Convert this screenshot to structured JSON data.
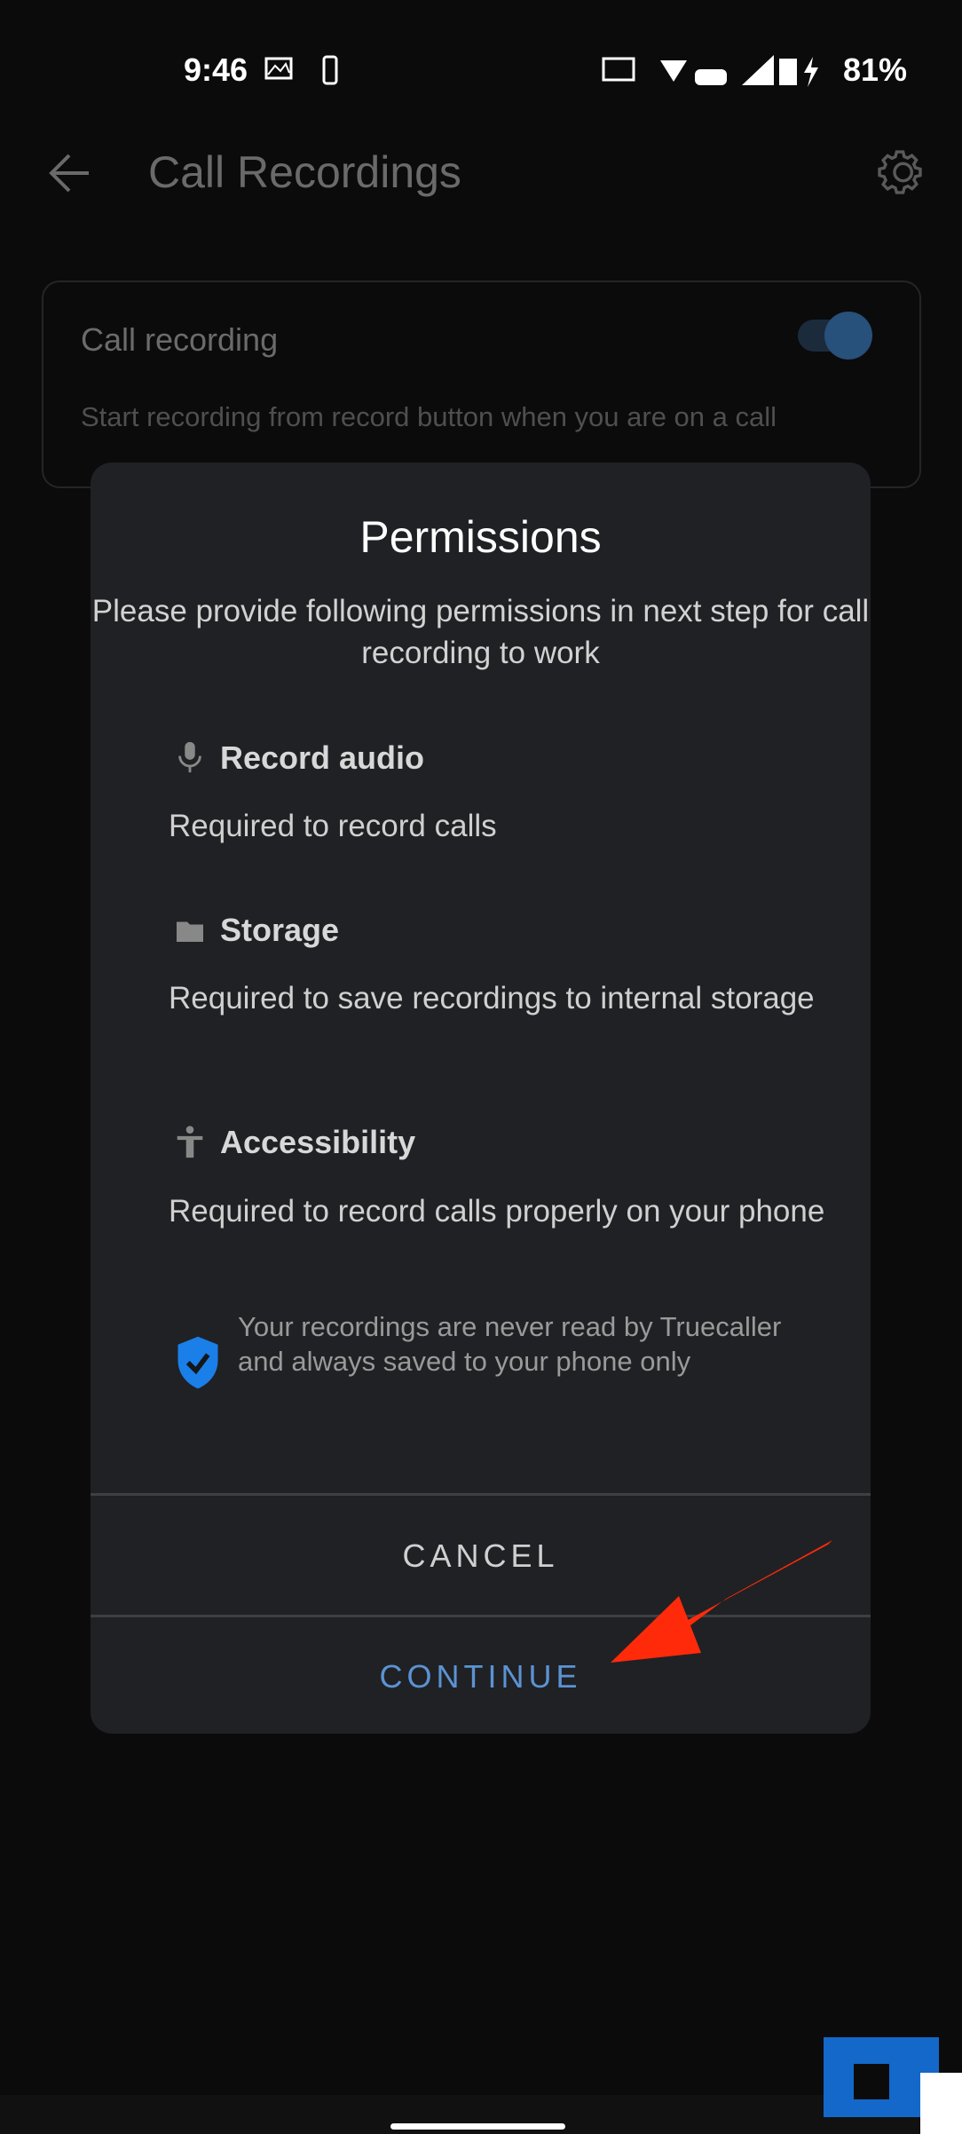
{
  "status_bar": {
    "time": "9:46",
    "battery": "81%"
  },
  "header": {
    "title": "Call Recordings"
  },
  "card": {
    "title": "Call recording",
    "subtitle": "Start recording from record button when you are on a call",
    "toggle_on": true
  },
  "dialog": {
    "title": "Permissions",
    "intro": "Please provide following permissions in next step for call recording to work",
    "sections": [
      {
        "icon": "microphone-icon",
        "heading": "Record audio",
        "text": "Required to record calls"
      },
      {
        "icon": "folder-icon",
        "heading": "Storage",
        "text": "Required to save recordings to internal storage"
      },
      {
        "icon": "accessibility-icon",
        "heading": "Accessibility",
        "text": "Required to record calls properly on your phone"
      }
    ],
    "note": "Your recordings are never read by Truecaller and always saved to your phone only",
    "cancel_label": "CANCEL",
    "continue_label": "CONTINUE"
  },
  "colors": {
    "accent": "#5b93d3",
    "shield": "#1a7fe8",
    "arrow": "#ff2a0a"
  }
}
